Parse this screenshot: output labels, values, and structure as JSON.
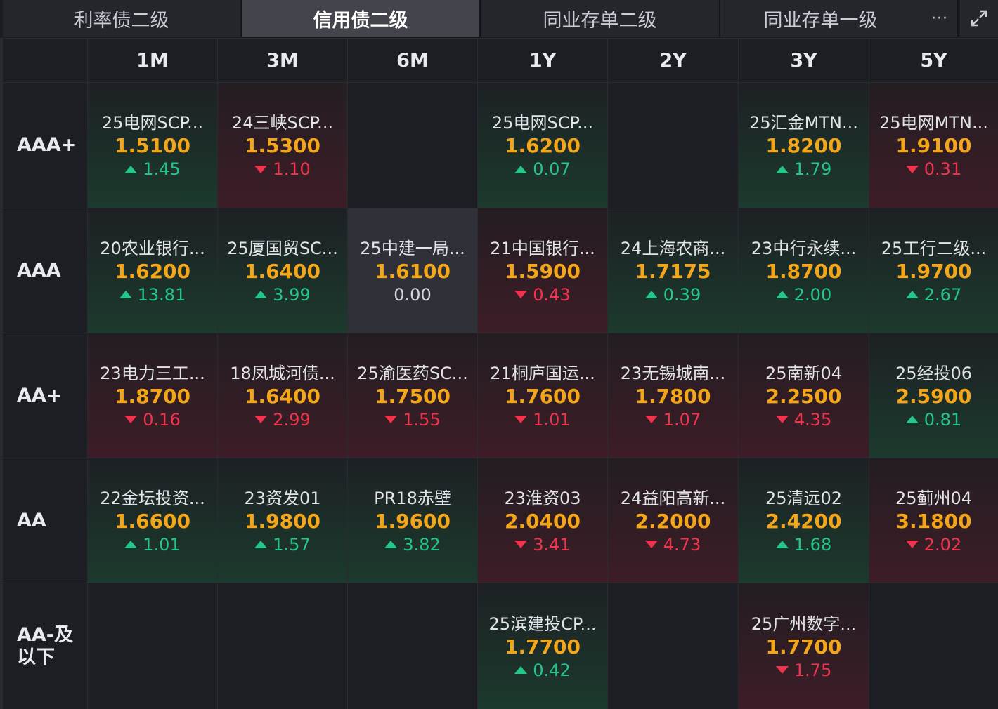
{
  "tabs": [
    {
      "label": "利率债二级",
      "active": false
    },
    {
      "label": "信用债二级",
      "active": true
    },
    {
      "label": "同业存单二级",
      "active": false
    },
    {
      "label": "同业存单一级",
      "active": false
    }
  ],
  "more_label": "···",
  "columns": [
    "1M",
    "3M",
    "6M",
    "1Y",
    "2Y",
    "3Y",
    "5Y"
  ],
  "rows": [
    {
      "rating": "AAA+",
      "cells": [
        {
          "name": "25电网SCP...",
          "rate": "1.5100",
          "change": "1.45",
          "dir": "up"
        },
        {
          "name": "24三峡SCP...",
          "rate": "1.5300",
          "change": "1.10",
          "dir": "down"
        },
        null,
        {
          "name": "25电网SCP...",
          "rate": "1.6200",
          "change": "0.07",
          "dir": "up"
        },
        null,
        {
          "name": "25汇金MTN...",
          "rate": "1.8200",
          "change": "1.79",
          "dir": "up"
        },
        {
          "name": "25电网MTN...",
          "rate": "1.9100",
          "change": "0.31",
          "dir": "down"
        }
      ]
    },
    {
      "rating": "AAA",
      "cells": [
        {
          "name": "20农业银行...",
          "rate": "1.6200",
          "change": "13.81",
          "dir": "up"
        },
        {
          "name": "25厦国贸SC...",
          "rate": "1.6400",
          "change": "3.99",
          "dir": "up"
        },
        {
          "name": "25中建一局...",
          "rate": "1.6100",
          "change": "0.00",
          "dir": "flat"
        },
        {
          "name": "21中国银行...",
          "rate": "1.5900",
          "change": "0.43",
          "dir": "down"
        },
        {
          "name": "24上海农商...",
          "rate": "1.7175",
          "change": "0.39",
          "dir": "up"
        },
        {
          "name": "23中行永续...",
          "rate": "1.8700",
          "change": "2.00",
          "dir": "up"
        },
        {
          "name": "25工行二级...",
          "rate": "1.9700",
          "change": "2.67",
          "dir": "up"
        }
      ]
    },
    {
      "rating": "AA+",
      "cells": [
        {
          "name": "23电力三工...",
          "rate": "1.8700",
          "change": "0.16",
          "dir": "down"
        },
        {
          "name": "18凤城河债...",
          "rate": "1.6400",
          "change": "2.99",
          "dir": "down"
        },
        {
          "name": "25渝医药SC...",
          "rate": "1.7500",
          "change": "1.55",
          "dir": "down"
        },
        {
          "name": "21桐庐国运...",
          "rate": "1.7600",
          "change": "1.01",
          "dir": "down"
        },
        {
          "name": "23无锡城南...",
          "rate": "1.7800",
          "change": "1.07",
          "dir": "down"
        },
        {
          "name": "25南新04",
          "rate": "2.2500",
          "change": "4.35",
          "dir": "down"
        },
        {
          "name": "25经投06",
          "rate": "2.5900",
          "change": "0.81",
          "dir": "up"
        }
      ]
    },
    {
      "rating": "AA",
      "cells": [
        {
          "name": "22金坛投资...",
          "rate": "1.6600",
          "change": "1.01",
          "dir": "up"
        },
        {
          "name": "23资发01",
          "rate": "1.9800",
          "change": "1.57",
          "dir": "up"
        },
        {
          "name": "PR18赤壁",
          "rate": "1.9600",
          "change": "3.82",
          "dir": "up"
        },
        {
          "name": "23淮资03",
          "rate": "2.0400",
          "change": "3.41",
          "dir": "down"
        },
        {
          "name": "24益阳高新...",
          "rate": "2.2000",
          "change": "4.73",
          "dir": "down"
        },
        {
          "name": "25清远02",
          "rate": "2.4200",
          "change": "1.68",
          "dir": "up"
        },
        {
          "name": "25蓟州04",
          "rate": "3.1800",
          "change": "2.02",
          "dir": "down"
        }
      ]
    },
    {
      "rating": "AA-及以下",
      "cells": [
        null,
        null,
        null,
        {
          "name": "25滨建投CP...",
          "rate": "1.7700",
          "change": "0.42",
          "dir": "up"
        },
        null,
        {
          "name": "25广州数字...",
          "rate": "1.7700",
          "change": "1.75",
          "dir": "down"
        },
        null
      ]
    }
  ],
  "icons": {
    "more": "more-icon",
    "expand": "expand-icon",
    "up": "triangle-up-icon",
    "down": "triangle-down-icon"
  },
  "colors": {
    "accent_rate": "#f4a61b",
    "up": "#25c68a",
    "down": "#f1344e"
  }
}
